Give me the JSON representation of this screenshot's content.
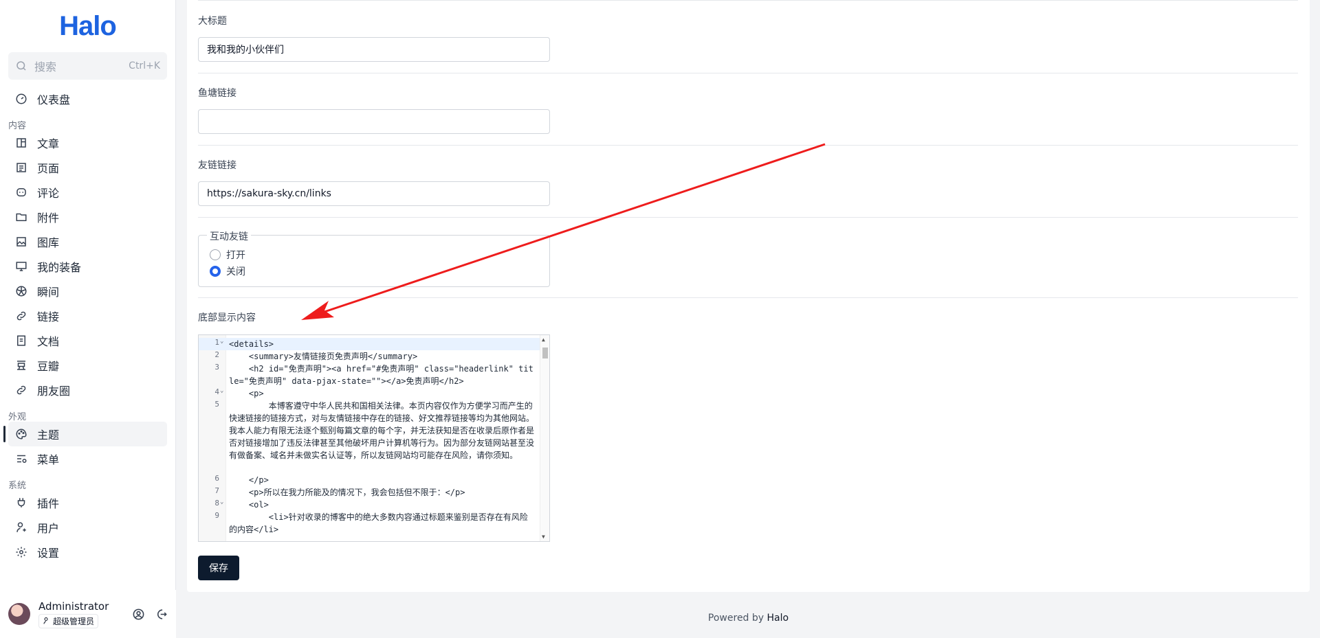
{
  "app": {
    "logo": "Halo"
  },
  "search": {
    "placeholder": "搜索",
    "shortcut": "Ctrl+K"
  },
  "sidebar": {
    "dashboard": "仪表盘",
    "groups": {
      "content": "内容",
      "appearance": "外观",
      "system": "系统"
    },
    "content_items": [
      "文章",
      "页面",
      "评论",
      "附件",
      "图库",
      "我的装备",
      "瞬间",
      "链接",
      "文档",
      "豆瓣",
      "朋友圈"
    ],
    "appearance_items": [
      "主题",
      "菜单"
    ],
    "system_items": [
      "插件",
      "用户",
      "设置"
    ]
  },
  "user": {
    "name": "Administrator",
    "role": "超级管理员"
  },
  "form": {
    "title_label": "大标题",
    "title_value": "我和我的小伙伴们",
    "fishpond_label": "鱼塘链接",
    "fishpond_value": "",
    "friendlink_label": "友链链接",
    "friendlink_value": "https://sakura-sky.cn/links",
    "mutual_label": "互动友链",
    "mutual_options": [
      "打开",
      "关闭"
    ],
    "mutual_selected": "关闭",
    "footer_content_label": "底部显示内容",
    "save_label": "保存"
  },
  "editor": {
    "line_numbers": [
      "1",
      "2",
      "3",
      "4",
      "5",
      "6",
      "7",
      "8",
      "9"
    ],
    "lines": [
      "<details>",
      "    <summary>友情链接页免责声明</summary>",
      "    <h2 id=\"免责声明\"><a href=\"#免责声明\" class=\"headerlink\" title=\"免责声明\" data-pjax-state=\"\"></a>免责声明</h2>",
      "    <p>",
      "        本博客遵守中华人民共和国相关法律。本页内容仅作为方便学习而产生的快速链接的链接方式，对与友情链接中存在的链接、好文推荐链接等均为其他网站。我本人能力有限无法逐个甄别每篇文章的每个字，并无法获知是否在收录后原作者是否对链接增加了违反法律甚至其他破坏用户计算机等行为。因为部分友链网站甚至没有做备案、域名并未做实名认证等，所以友链网站均可能存在风险，请你须知。",
      "    </p>",
      "    <p>所以在我力所能及的情况下，我会包括但不限于：</p>",
      "    <ol>",
      "        <li>针对收录的博客中的绝大多数内容通过标题来鉴别是否存在有风险的内容</li>"
    ]
  },
  "footer": {
    "prefix": "Powered by ",
    "brand": "Halo"
  },
  "colors": {
    "accent": "#2563eb",
    "button": "#0d1b2e",
    "annotation_arrow": "#ee1c1c"
  }
}
